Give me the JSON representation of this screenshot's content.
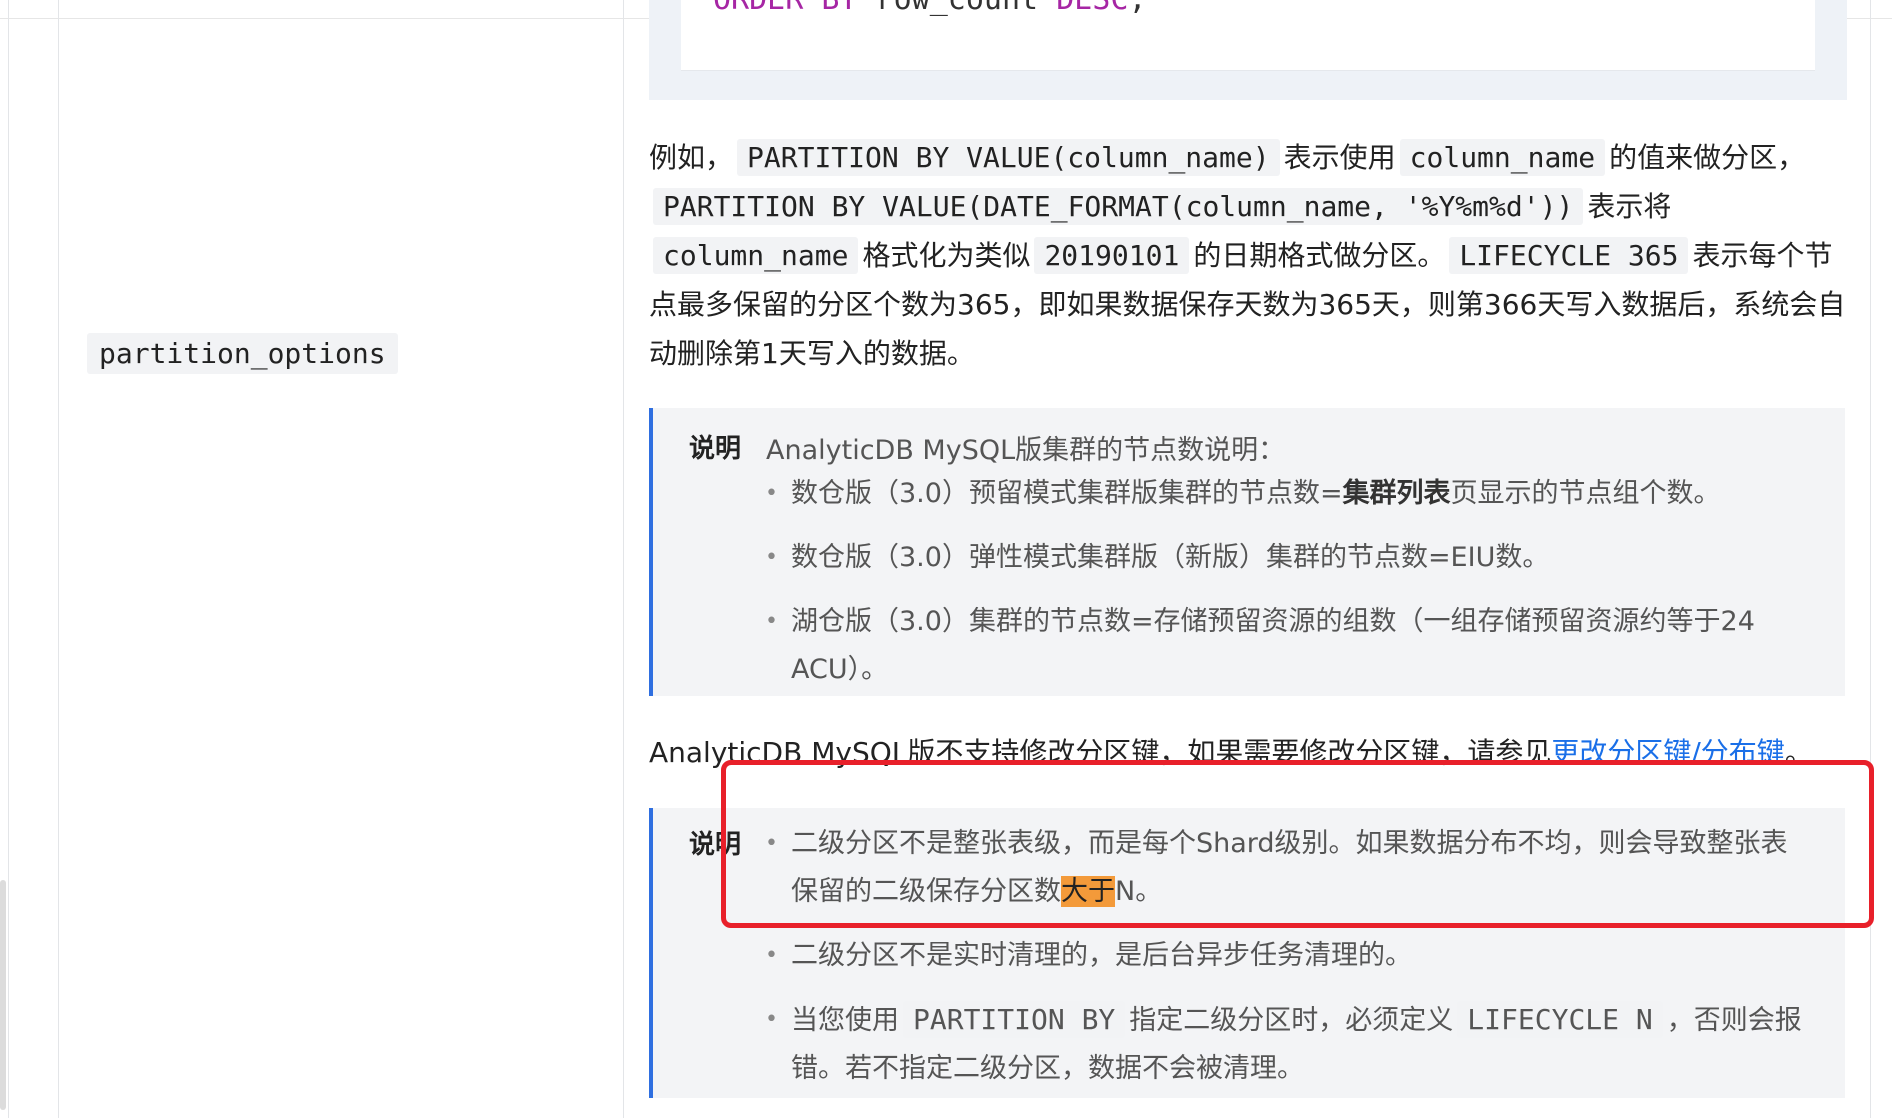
{
  "code_block": {
    "line_kw1": "ORDER BY",
    "line_plain": " row_count ",
    "line_kw2": "DESC",
    "line_end": ";"
  },
  "param": {
    "name": "partition_options"
  },
  "paragraph": {
    "t1": "例如，",
    "c1": "PARTITION BY VALUE(column_name)",
    "t2": "表示使用",
    "c2": "column_name",
    "t3": "的值来做分区，",
    "c3": "PARTITION BY VALUE(DATE_FORMAT(column_name, '%Y%m%d'))",
    "t4": "表示将",
    "c4": "column_name",
    "t5": "格式化为类似",
    "c5": "20190101",
    "t6": "的日期格式做分区。",
    "c6": "LIFECYCLE 365",
    "t7": "表示每个节点最多保留的分区个数为365，即如果数据保存天数为365天，则第366天写入数据后，系统会自动删除第1天写入的数据。"
  },
  "note1": {
    "label": "说明",
    "head": "AnalyticDB MySQL版集群的节点数说明：",
    "item1_pre": "数仓版（3.0）预留模式集群版集群的节点数=",
    "item1_bold": "集群列表",
    "item1_post": "页显示的节点组个数。",
    "item2": "数仓版（3.0）弹性模式集群版（新版）集群的节点数=EIU数。",
    "item3": "湖仓版（3.0）集群的节点数=存储预留资源的组数（一组存储预留资源约等于24 ACU）。"
  },
  "middle": {
    "text": "AnalyticDB MySQL版不支持修改分区键，如果需要修改分区键，请参见",
    "link": "更改分区键/分布键",
    "end": "。"
  },
  "note2": {
    "label": "说明",
    "item1_pre": "二级分区不是整张表级，而是每个Shard级别。如果数据分布不均，则会导致整张表保留的二级保存分区数",
    "item1_hl": "大于",
    "item1_post": "N。",
    "item2": "二级分区不是实时清理的，是后台异步任务清理的。",
    "item3_pre": "当您使用",
    "item3_c1": "PARTITION BY",
    "item3_mid": "指定二级分区时，必须定义",
    "item3_c2": "LIFECYCLE N",
    "item3_post": "，否则会报错。若不指定二级分区，数据不会被清理。"
  },
  "colors": {
    "accent_blue": "#2f6fe0",
    "link_blue": "#1a6fe8",
    "highlight_orange": "#f39a3a",
    "annotation_red": "#e8202a"
  }
}
